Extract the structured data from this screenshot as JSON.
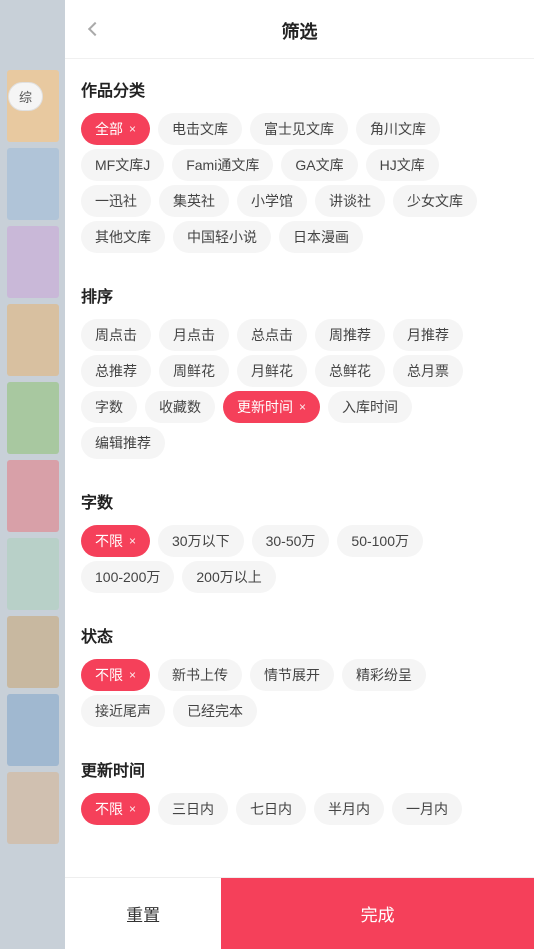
{
  "header": {
    "title": "筛选",
    "back_label": "‹"
  },
  "sections": [
    {
      "id": "category",
      "title": "作品分类",
      "rows": [
        [
          {
            "label": "全部",
            "active": true,
            "has_close": true
          },
          {
            "label": "电击文库",
            "active": false
          },
          {
            "label": "富士见文库",
            "active": false
          },
          {
            "label": "角川文库",
            "active": false
          }
        ],
        [
          {
            "label": "MF文库J",
            "active": false
          },
          {
            "label": "Fami通文库",
            "active": false
          },
          {
            "label": "GA文库",
            "active": false
          },
          {
            "label": "HJ文库",
            "active": false
          }
        ],
        [
          {
            "label": "一迅社",
            "active": false
          },
          {
            "label": "集英社",
            "active": false
          },
          {
            "label": "小学馆",
            "active": false
          },
          {
            "label": "讲谈社",
            "active": false
          },
          {
            "label": "少女文库",
            "active": false
          }
        ],
        [
          {
            "label": "其他文库",
            "active": false
          },
          {
            "label": "中国轻小说",
            "active": false
          },
          {
            "label": "日本漫画",
            "active": false
          }
        ]
      ]
    },
    {
      "id": "sort",
      "title": "排序",
      "rows": [
        [
          {
            "label": "周点击",
            "active": false
          },
          {
            "label": "月点击",
            "active": false
          },
          {
            "label": "总点击",
            "active": false
          },
          {
            "label": "周推荐",
            "active": false
          },
          {
            "label": "月推荐",
            "active": false
          }
        ],
        [
          {
            "label": "总推荐",
            "active": false
          },
          {
            "label": "周鲜花",
            "active": false
          },
          {
            "label": "月鲜花",
            "active": false
          },
          {
            "label": "总鲜花",
            "active": false
          },
          {
            "label": "总月票",
            "active": false
          }
        ],
        [
          {
            "label": "字数",
            "active": false
          },
          {
            "label": "收藏数",
            "active": false
          },
          {
            "label": "更新时间",
            "active": true,
            "has_close": true
          },
          {
            "label": "入库时间",
            "active": false
          }
        ],
        [
          {
            "label": "编辑推荐",
            "active": false
          }
        ]
      ]
    },
    {
      "id": "wordcount",
      "title": "字数",
      "rows": [
        [
          {
            "label": "不限",
            "active": true,
            "has_close": true
          },
          {
            "label": "30万以下",
            "active": false
          },
          {
            "label": "30-50万",
            "active": false
          },
          {
            "label": "50-100万",
            "active": false
          }
        ],
        [
          {
            "label": "100-200万",
            "active": false
          },
          {
            "label": "200万以上",
            "active": false
          }
        ]
      ]
    },
    {
      "id": "status",
      "title": "状态",
      "rows": [
        [
          {
            "label": "不限",
            "active": true,
            "has_close": true
          },
          {
            "label": "新书上传",
            "active": false
          },
          {
            "label": "情节展开",
            "active": false
          },
          {
            "label": "精彩纷呈",
            "active": false
          }
        ],
        [
          {
            "label": "接近尾声",
            "active": false
          },
          {
            "label": "已经完本",
            "active": false
          }
        ]
      ]
    },
    {
      "id": "update_time",
      "title": "更新时间",
      "rows": [
        [
          {
            "label": "不限",
            "active": true,
            "has_close": true
          },
          {
            "label": "三日内",
            "active": false
          },
          {
            "label": "七日内",
            "active": false
          },
          {
            "label": "半月内",
            "active": false
          },
          {
            "label": "一月内",
            "active": false
          }
        ]
      ]
    }
  ],
  "footer": {
    "reset_label": "重置",
    "confirm_label": "完成"
  },
  "left_panel": {
    "zong_label": "综"
  }
}
